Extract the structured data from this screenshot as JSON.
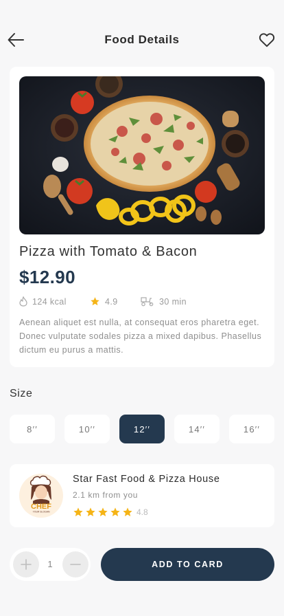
{
  "header": {
    "title": "Food Details",
    "back_icon": "arrow-left-icon",
    "favorite_icon": "heart-outline-icon"
  },
  "food": {
    "name": "Pizza with Tomato & Bacon",
    "price": "$12.90",
    "calories": "124 kcal",
    "rating": "4.9",
    "delivery_time": "30 min",
    "description": "Aenean aliquet est nulla, at consequat eros pharetra eget. Donec vulputate sodales pizza a mixed dapibus. Phasellus dictum eu purus a mattis."
  },
  "size": {
    "title": "Size",
    "options": [
      "8′′",
      "10′′",
      "12′′",
      "14′′",
      "16′′"
    ],
    "selected": "12′′"
  },
  "restaurant": {
    "name": "Star Fast Food & Pizza House",
    "distance": "2.1 km from you",
    "stars": 5,
    "rating": "4.8",
    "logo_text": "CHEF",
    "logo_slogan": "YOUR SLOGAN"
  },
  "order": {
    "quantity": "1",
    "add_label": "ADD TO CARD"
  },
  "colors": {
    "primary": "#24394f",
    "star": "#f5b417",
    "background": "#f7f7f8"
  }
}
